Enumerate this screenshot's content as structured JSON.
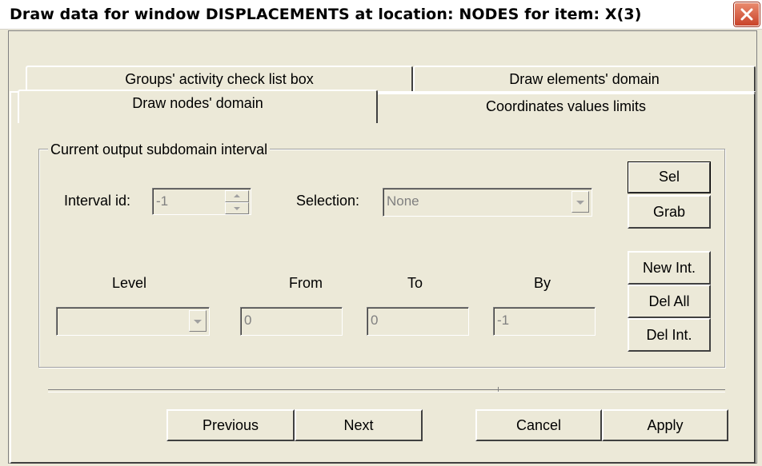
{
  "window": {
    "title": "Draw data for window DISPLACEMENTS at location: NODES for item: X(3)"
  },
  "tabs": {
    "back_row": [
      "Groups' activity check list box",
      "Draw elements' domain"
    ],
    "front_row": [
      "Draw nodes' domain",
      "Coordinates values limits"
    ],
    "active": "Draw nodes' domain"
  },
  "group": {
    "label": "Current output subdomain interval",
    "interval_id_label": "Interval id:",
    "interval_id_value": "-1",
    "selection_label": "Selection:",
    "selection_value": "None",
    "columns": {
      "level": "Level",
      "from": "From",
      "to": "To",
      "by": "By"
    },
    "values": {
      "level": "",
      "from": "0",
      "to": "0",
      "by": "-1"
    }
  },
  "side_buttons": {
    "sel": "Sel",
    "grab": "Grab",
    "new_int": "New Int.",
    "del_all": "Del All",
    "del_int": "Del Int."
  },
  "bottom_buttons": {
    "previous": "Previous",
    "next": "Next",
    "cancel": "Cancel",
    "apply": "Apply"
  },
  "icons": {
    "close": "close-icon"
  },
  "colors": {
    "face": "#ece9d8",
    "close_red": "#c9432a",
    "disabled_text": "#808080"
  }
}
